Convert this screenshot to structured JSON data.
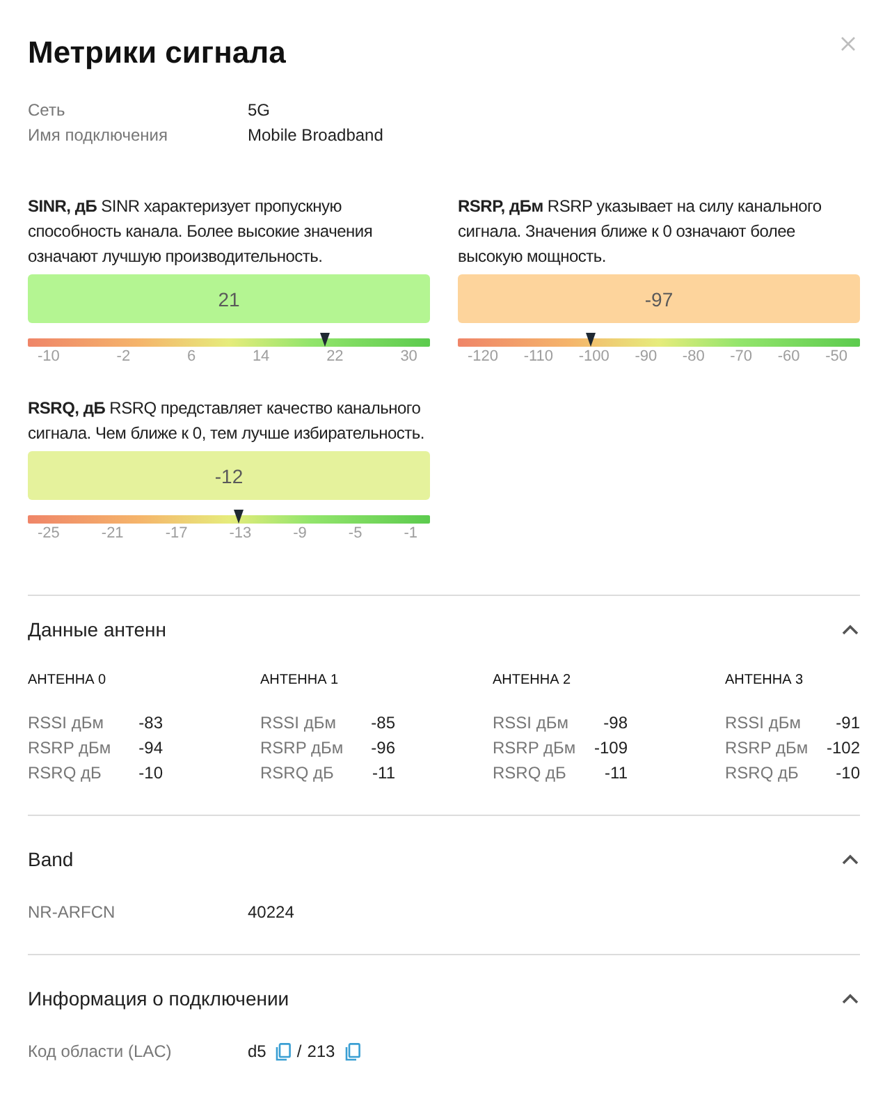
{
  "dialog": {
    "title": "Метрики сигнала"
  },
  "info": [
    {
      "label": "Сеть",
      "value": "5G"
    },
    {
      "label": "Имя подключения",
      "value": "Mobile Broadband"
    }
  ],
  "metrics": [
    {
      "text": "**SINR, дБ** SINR характеризует пропускную способность канала. Более высокие значения означают лучшую производительность.",
      "value": "21",
      "color": "#b4f592",
      "level": 0.74,
      "ticks": [
        "-10",
        "-2",
        "6",
        "14",
        "22",
        "30"
      ]
    },
    {
      "text": "**RSRP, дБм** RSRP указывает на силу канального сигнала. Значения ближе к 0 означают более высокую мощность.",
      "value": "-97",
      "color": "#fdd49c",
      "level": 0.33,
      "ticks": [
        "-120",
        "-110",
        "-100",
        "-90",
        "-80",
        "-70",
        "-60",
        "-50"
      ]
    },
    {
      "text": "**RSRQ, дБ** RSRQ представляет качество канального сигнала. Чем ближе к 0, тем лучше избирательность.",
      "value": "-12",
      "color": "#e5f29c",
      "level": 0.525,
      "ticks": [
        "-25",
        "-21",
        "-17",
        "-13",
        "-9",
        "-5",
        "-1"
      ]
    }
  ],
  "sections": [
    {
      "title": "Данные антенн",
      "expanded": true,
      "kind": "antennas",
      "antennas": [
        {
          "name": "АНТЕННА 0",
          "rows": [
            {
              "label": "RSSI дБм",
              "value": "-83"
            },
            {
              "label": "RSRP дБм",
              "value": "-94"
            },
            {
              "label": "RSRQ дБ",
              "value": "-10"
            }
          ]
        },
        {
          "name": "АНТЕННА 1",
          "rows": [
            {
              "label": "RSSI дБм",
              "value": "-85"
            },
            {
              "label": "RSRP дБм",
              "value": "-96"
            },
            {
              "label": "RSRQ дБ",
              "value": "-11"
            }
          ]
        },
        {
          "name": "АНТЕННА 2",
          "rows": [
            {
              "label": "RSSI дБм",
              "value": "-98"
            },
            {
              "label": "RSRP дБм",
              "value": "-109"
            },
            {
              "label": "RSRQ дБ",
              "value": "-11"
            }
          ]
        },
        {
          "name": "АНТЕННА 3",
          "rows": [
            {
              "label": "RSSI дБм",
              "value": "-91"
            },
            {
              "label": "RSRP дБм",
              "value": "-102"
            },
            {
              "label": "RSRQ дБ",
              "value": "-10"
            }
          ]
        }
      ]
    },
    {
      "title": "Band",
      "expanded": true,
      "kind": "fields",
      "fields": [
        {
          "label": "NR-ARFCN",
          "values": [
            "40224"
          ]
        }
      ]
    },
    {
      "title": "Информация о подключении",
      "expanded": true,
      "kind": "fields",
      "fields": [
        {
          "label": "Код области (LAC)",
          "values": [
            "d5",
            "213"
          ],
          "separator": "/",
          "copyable": true
        }
      ]
    }
  ]
}
